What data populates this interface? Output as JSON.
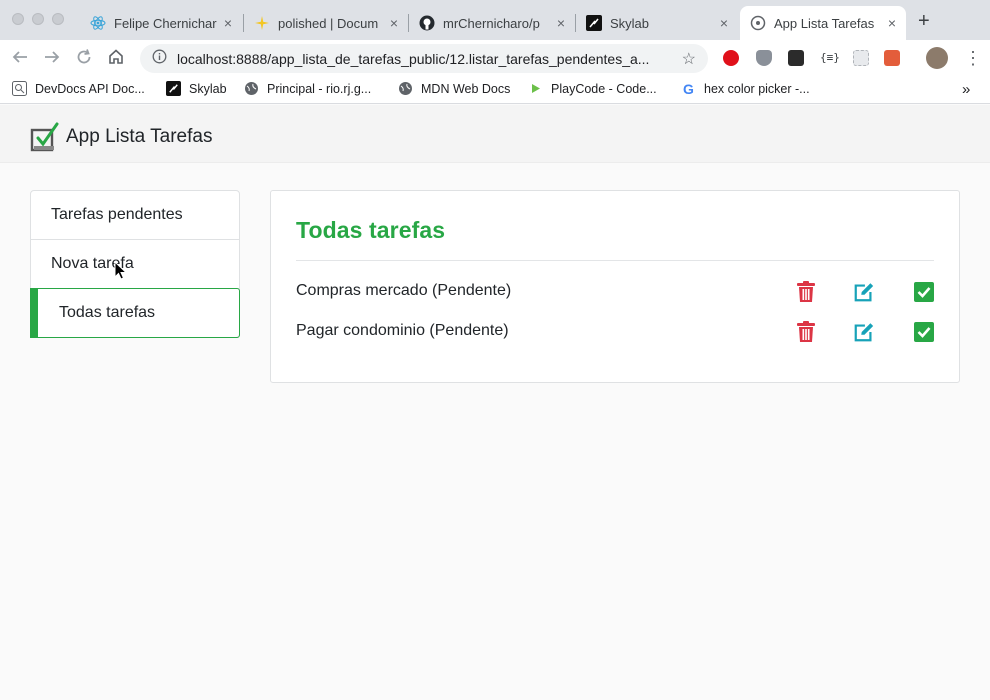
{
  "browser": {
    "tabs": [
      {
        "title": "Felipe Chernichar",
        "icon": "react-icon"
      },
      {
        "title": "polished | Docum",
        "icon": "sparkle-icon"
      },
      {
        "title": "mrChernicharo/p",
        "icon": "github-icon"
      },
      {
        "title": "Skylab",
        "icon": "skylab-icon"
      },
      {
        "title": "App Lista Tarefas",
        "icon": "page-icon",
        "active": true
      }
    ],
    "close_glyph": "×",
    "new_tab_glyph": "+",
    "url": "localhost:8888/app_lista_de_tarefas_public/12.listar_tarefas_pendentes_a...",
    "bookmarks": [
      {
        "label": "DevDocs API Doc...",
        "icon": "devdocs-icon"
      },
      {
        "label": "Skylab",
        "icon": "skylab-icon"
      },
      {
        "label": "Principal - rio.rj.g...",
        "icon": "globe-icon"
      },
      {
        "label": "MDN Web Docs",
        "icon": "globe-icon"
      },
      {
        "label": "PlayCode - Code...",
        "icon": "playcode-icon"
      },
      {
        "label": "hex color picker -...",
        "icon": "google-icon"
      }
    ],
    "more_bookmarks_glyph": "»"
  },
  "app": {
    "brand": "App Lista Tarefas",
    "menu": [
      {
        "label": "Tarefas pendentes"
      },
      {
        "label": "Nova tarefa"
      },
      {
        "label": "Todas tarefas",
        "active": true
      }
    ],
    "section_title": "Todas tarefas",
    "tasks": [
      {
        "text": "Compras mercado (Pendente)"
      },
      {
        "text": "Pagar condominio (Pendente)"
      }
    ]
  },
  "colors": {
    "accent_green": "#28a745",
    "delete_red": "#dc3545",
    "edit_teal": "#17a2b8"
  }
}
